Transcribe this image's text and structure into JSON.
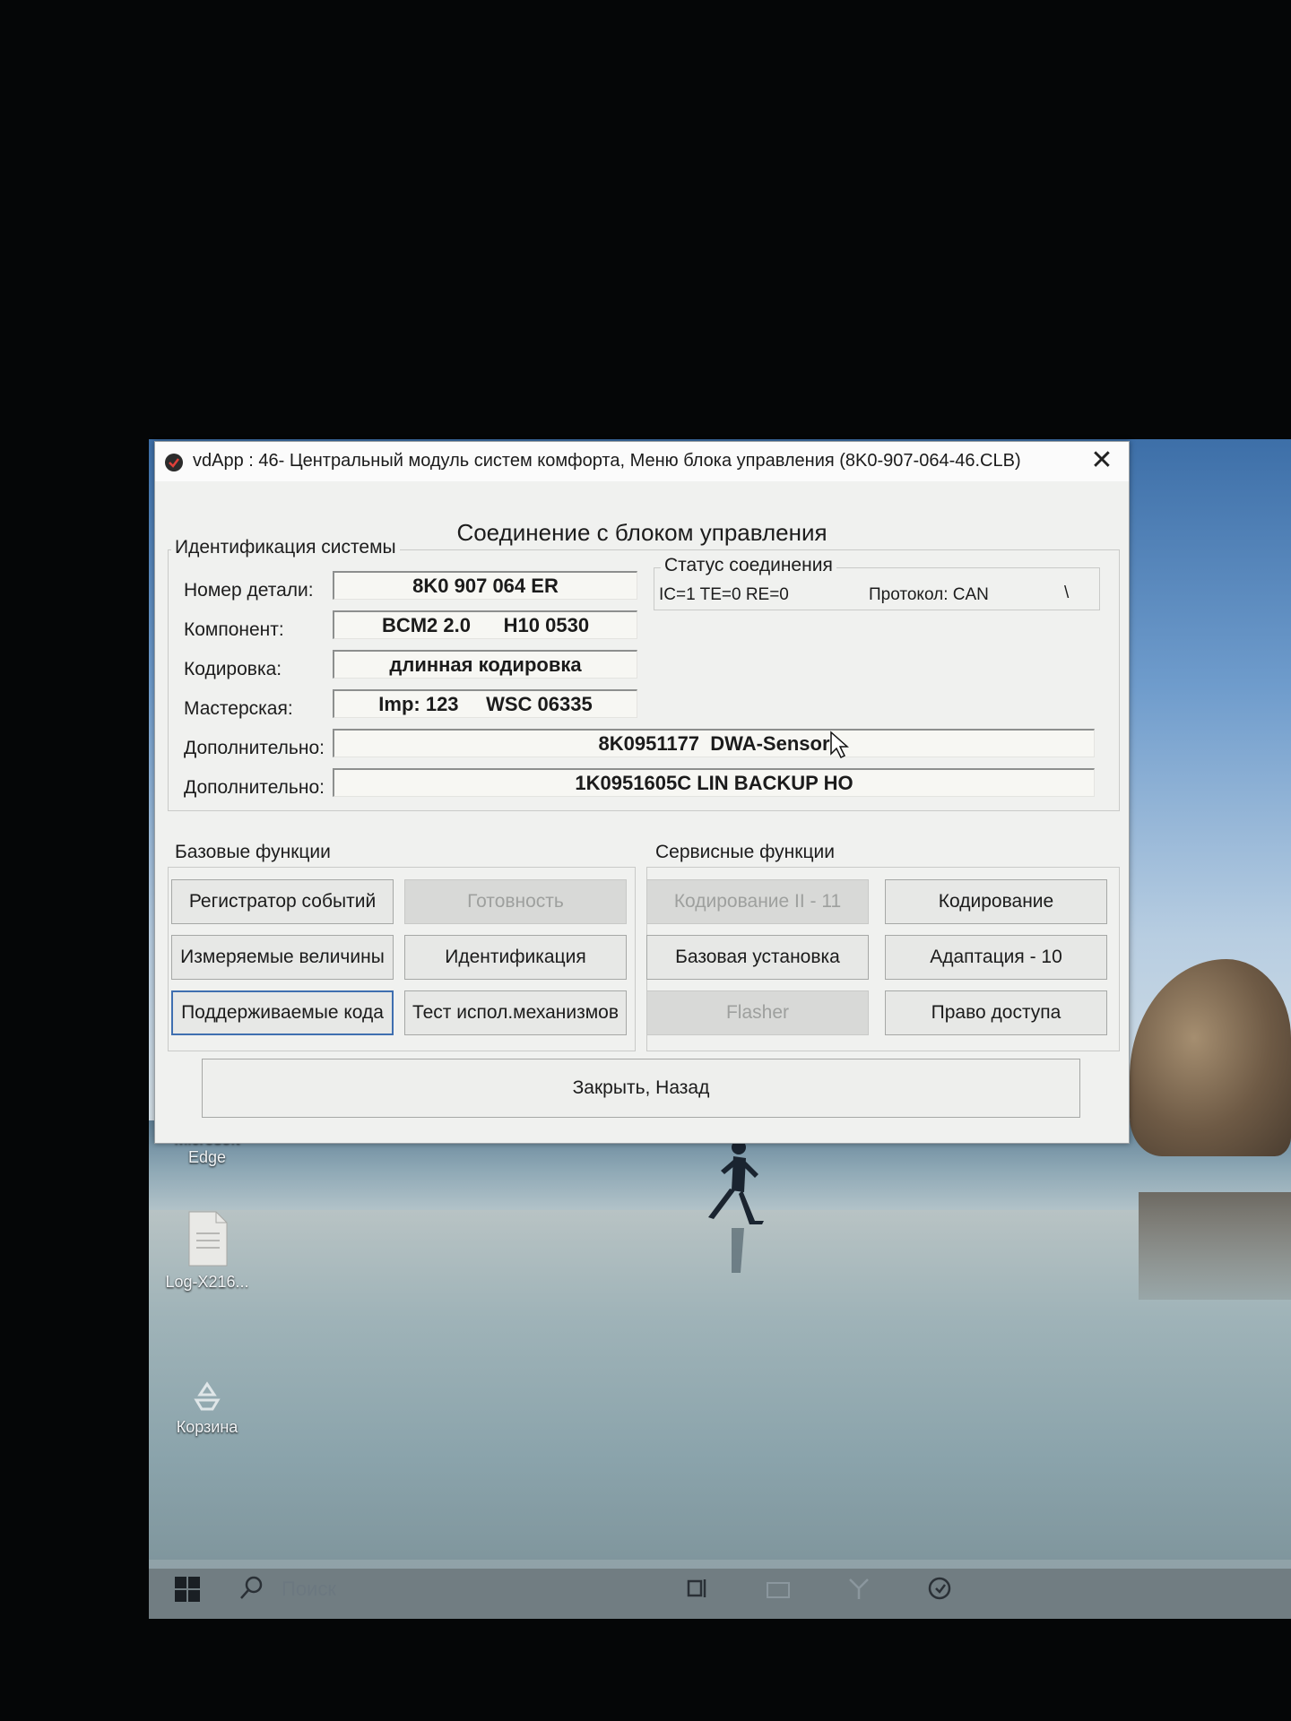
{
  "window": {
    "title": "vdApp : 46- Центральный модуль систем комфорта,  Меню блока управления (8K0-907-064-46.CLB)",
    "close_glyph": "✕",
    "header": "Соединение с блоком управления"
  },
  "identification": {
    "caption": "Идентификация системы",
    "rows": [
      {
        "label": "Номер детали:",
        "value": "8K0 907 064 ER"
      },
      {
        "label": "Компонент:",
        "value": "BCM2 2.0      H10 0530"
      },
      {
        "label": "Кодировка:",
        "value": "длинная кодировка"
      },
      {
        "label": "Мастерская:",
        "value": "Imp: 123     WSC 06335"
      },
      {
        "label": "Дополнительно:",
        "value": "8K0951177  DWA-Sensor"
      },
      {
        "label": "Дополнительно:",
        "value": "1K0951605C LIN BACKUP HO"
      }
    ]
  },
  "connection_status": {
    "caption": "Статус соединения",
    "counters": "IC=1  TE=0   RE=0",
    "protocol": "Протокол: CAN",
    "spinner": "\\"
  },
  "basic_functions": {
    "caption": "Базовые функции",
    "buttons": [
      {
        "label": "Регистратор событий",
        "enabled": true
      },
      {
        "label": "Готовность",
        "enabled": false
      },
      {
        "label": "Измеряемые величины",
        "enabled": true
      },
      {
        "label": "Идентификация",
        "enabled": true
      },
      {
        "label": "Поддерживаемые кода",
        "enabled": true,
        "focused": true
      },
      {
        "label": "Тест испол.механизмов",
        "enabled": true
      }
    ]
  },
  "service_functions": {
    "caption": "Сервисные функции",
    "buttons": [
      {
        "label": "Кодирование II - 11",
        "enabled": false
      },
      {
        "label": "Кодирование",
        "enabled": true
      },
      {
        "label": "Базовая установка",
        "enabled": true
      },
      {
        "label": "Адаптация - 10",
        "enabled": true
      },
      {
        "label": "Flasher",
        "enabled": false
      },
      {
        "label": "Право доступа",
        "enabled": true
      }
    ]
  },
  "close_back_button": "Закрыть, Назад",
  "desktop": {
    "icons": [
      {
        "label": "Microsoft Edge",
        "icon": "edge-icon"
      },
      {
        "label": "Log-X216...",
        "icon": "document-icon"
      },
      {
        "label": "Корзина",
        "icon": "recycle-bin-icon"
      }
    ]
  },
  "taskbar": {
    "search_placeholder": "Поиск"
  }
}
